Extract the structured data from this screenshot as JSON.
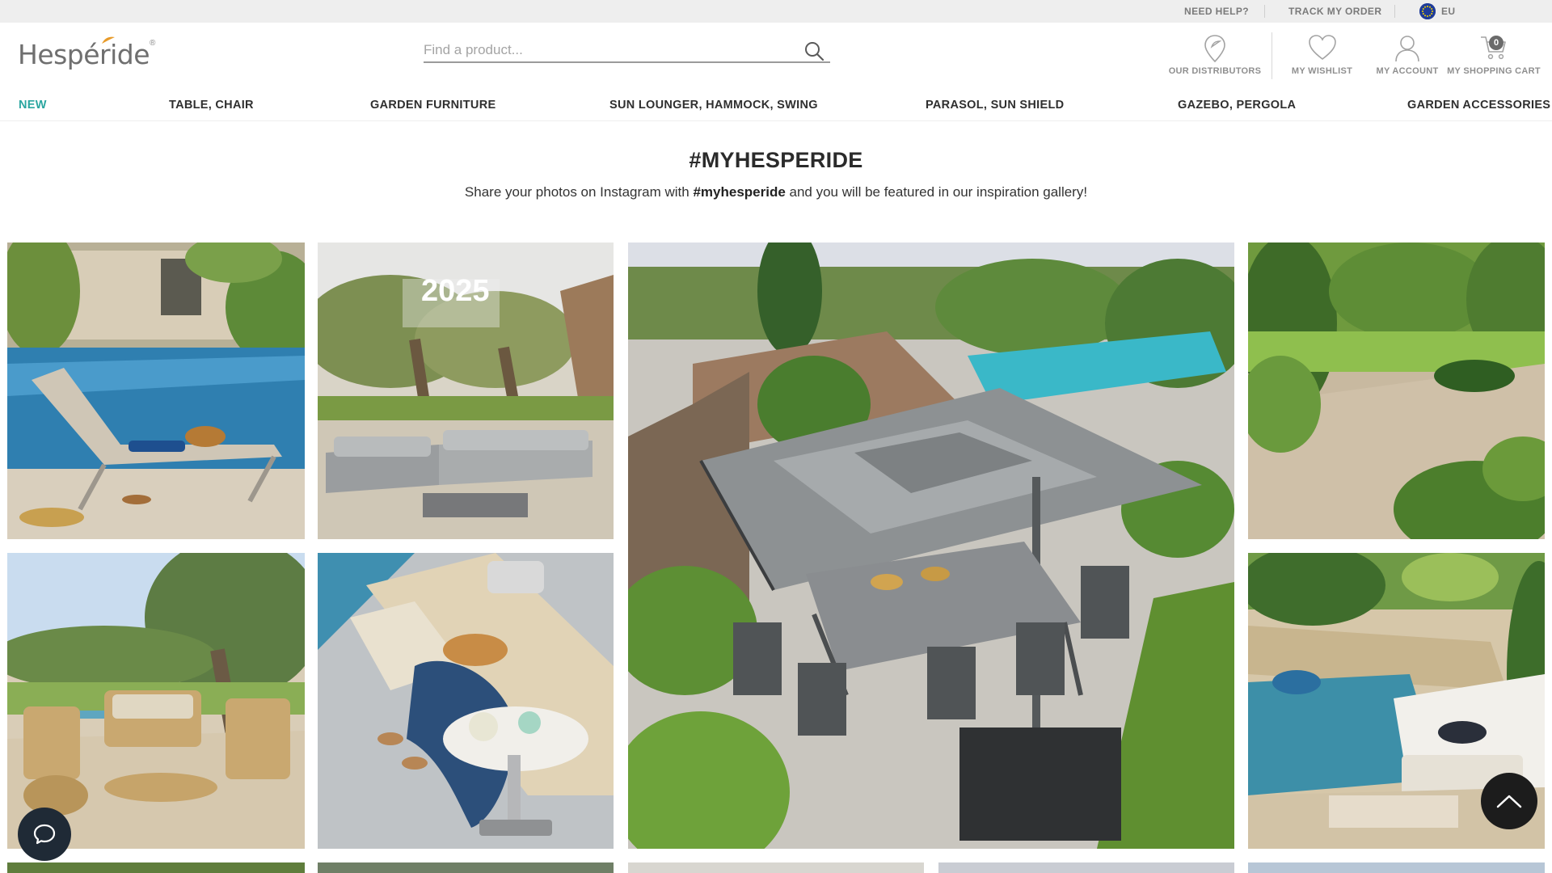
{
  "topbar": {
    "need_help": "NEED HELP?",
    "track_order": "TRACK MY ORDER",
    "region": "EU"
  },
  "header": {
    "logo_text": "Hespéride",
    "logo_mark": "®",
    "search_placeholder": "Find a product...",
    "distributors": "OUR DISTRIBUTORS",
    "wishlist": "MY WISHLIST",
    "account": "MY ACCOUNT",
    "cart": "MY SHOPPING CART",
    "cart_count": "0"
  },
  "nav": {
    "items": [
      "NEW",
      "TABLE, CHAIR",
      "GARDEN FURNITURE",
      "SUN LOUNGER, HAMMOCK, SWING",
      "PARASOL, SUN SHIELD",
      "GAZEBO, PERGOLA",
      "GARDEN ACCESSORIES"
    ]
  },
  "gallery": {
    "title": "#MYHESPERIDE",
    "subtitle_before": "Share your photos on Instagram with ",
    "subtitle_tag": "#myhesperide",
    "subtitle_after": " and you will be featured in our inspiration gallery!",
    "badge_text": "2025"
  },
  "colors": {
    "accent_new": "#2aa6a0",
    "topbar_bg": "#eeeeee",
    "chat_bg": "#1f2a36",
    "scroll_top_bg": "#1c1c1c"
  },
  "icons": {
    "search": "magnifier",
    "distributors": "map-pin",
    "wishlist": "heart",
    "account": "user",
    "cart": "shopping-cart",
    "chat": "chat-bubble",
    "scroll_top": "chevron-up"
  }
}
